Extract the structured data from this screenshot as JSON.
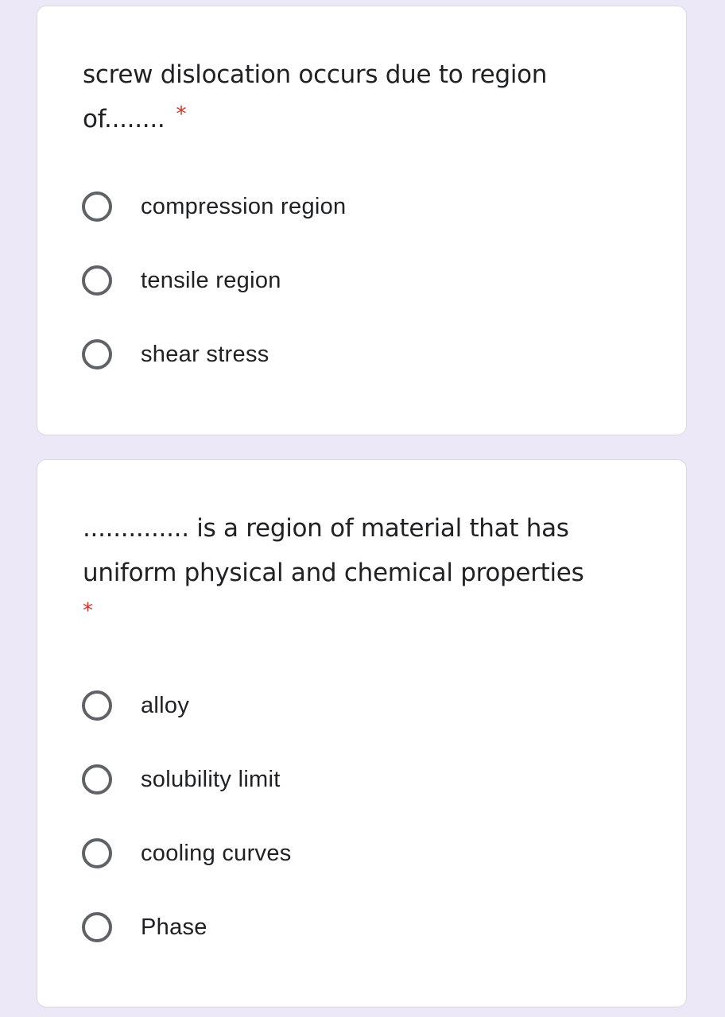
{
  "questions": [
    {
      "title": "screw dislocation occurs due to region of........",
      "required_marker": "*",
      "options": [
        {
          "label": "compression region",
          "selected": false
        },
        {
          "label": "tensile region",
          "selected": false
        },
        {
          "label": "shear stress",
          "selected": false
        }
      ]
    },
    {
      "title": ".............. is a region of material that has uniform physical and chemical properties",
      "required_marker": "*",
      "options": [
        {
          "label": "alloy",
          "selected": false
        },
        {
          "label": "solubility limit",
          "selected": false
        },
        {
          "label": "cooling curves",
          "selected": false
        },
        {
          "label": "Phase",
          "selected": false
        }
      ]
    }
  ],
  "colors": {
    "background": "#ece8f7",
    "card": "#ffffff",
    "required": "#d93025",
    "radio_border": "#5f6368",
    "text": "#202124"
  }
}
